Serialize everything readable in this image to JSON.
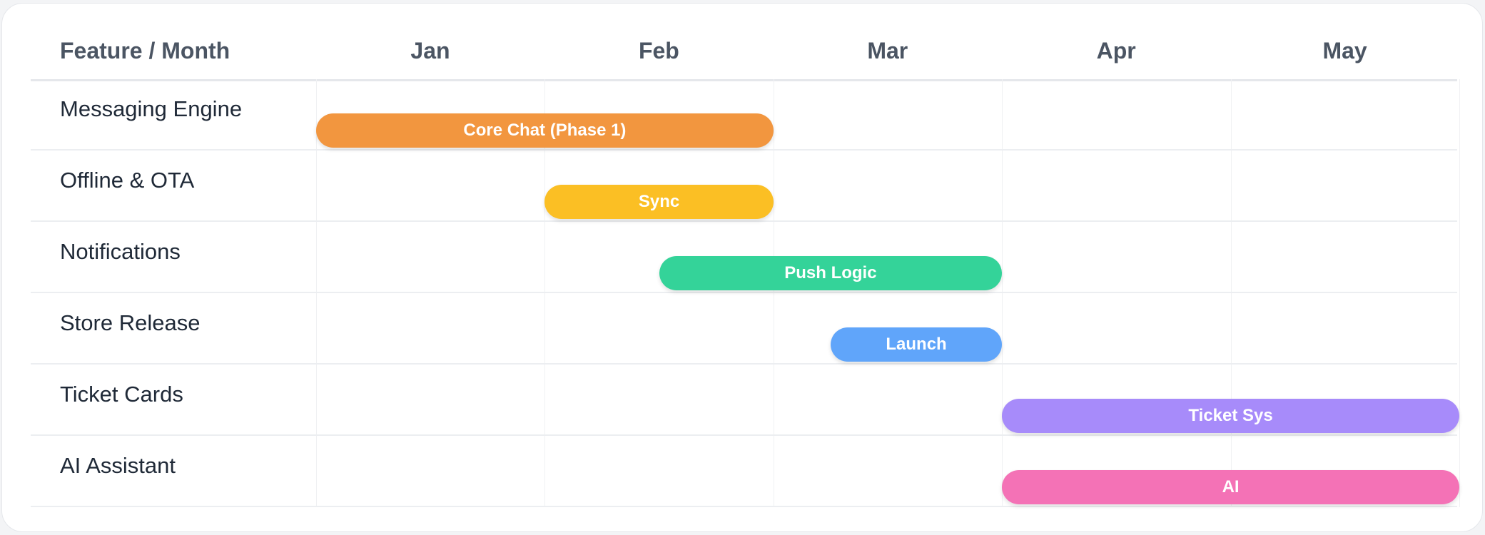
{
  "chart_data": {
    "type": "gantt",
    "corner_label": "Feature / Month",
    "months": [
      "Jan",
      "Feb",
      "Mar",
      "Apr",
      "May"
    ],
    "rows": [
      {
        "feature": "Messaging Engine",
        "task": "Core Chat (Phase 1)",
        "start": 0.0,
        "end": 2.0,
        "color": "#f2963f"
      },
      {
        "feature": "Offline & OTA",
        "task": "Sync",
        "start": 1.0,
        "end": 2.0,
        "color": "#fbbf24"
      },
      {
        "feature": "Notifications",
        "task": "Push Logic",
        "start": 1.5,
        "end": 3.0,
        "color": "#34d399"
      },
      {
        "feature": "Store Release",
        "task": "Launch",
        "start": 2.25,
        "end": 3.0,
        "color": "#60a5fa"
      },
      {
        "feature": "Ticket Cards",
        "task": "Ticket Sys",
        "start": 3.0,
        "end": 5.0,
        "color": "#a78bfa"
      },
      {
        "feature": "AI Assistant",
        "task": "AI",
        "start": 3.0,
        "end": 5.0,
        "color": "#f472b6"
      }
    ]
  }
}
